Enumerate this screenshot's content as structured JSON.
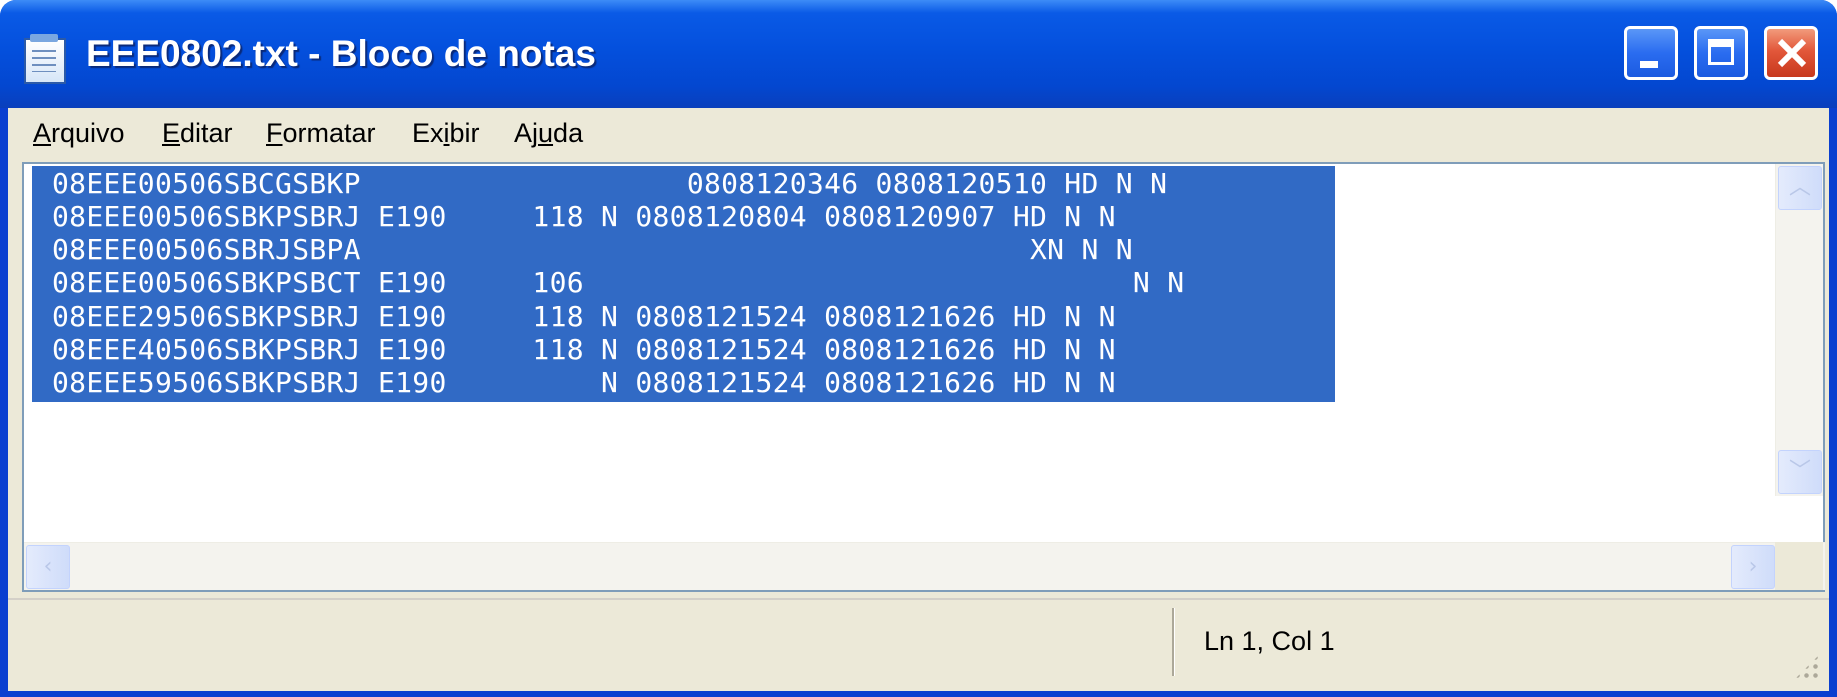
{
  "window": {
    "title": "EEE0802.txt - Bloco de notas",
    "icon": "notepad-icon",
    "accent_color": "#0a3fd0",
    "selection_color": "#316ac5"
  },
  "menu": {
    "items": [
      {
        "pre": "",
        "key": "A",
        "post": "rquivo"
      },
      {
        "pre": "",
        "key": "E",
        "post": "ditar"
      },
      {
        "pre": "",
        "key": "F",
        "post": "ormatar"
      },
      {
        "pre": "Ex",
        "key": "i",
        "post": "bir"
      },
      {
        "pre": "Aj",
        "key": "u",
        "post": "da"
      }
    ]
  },
  "document": {
    "lines": [
      "08EEE00506SBCGSBKP                   0808120346 0808120510 HD N N",
      "08EEE00506SBKPSBRJ E190     118 N 0808120804 0808120907 HD N N",
      "08EEE00506SBRJSBPA                                       XN N N",
      "08EEE00506SBKPSBCT E190     106                                N N",
      "08EEE29506SBKPSBRJ E190     118 N 0808121524 0808121626 HD N N",
      "08EEE40506SBKPSBRJ E190     118 N 0808121524 0808121626 HD N N",
      "08EEE59506SBKPSBRJ E190         N 0808121524 0808121626 HD N N"
    ]
  },
  "status": {
    "position": "Ln 1, Col 1"
  }
}
